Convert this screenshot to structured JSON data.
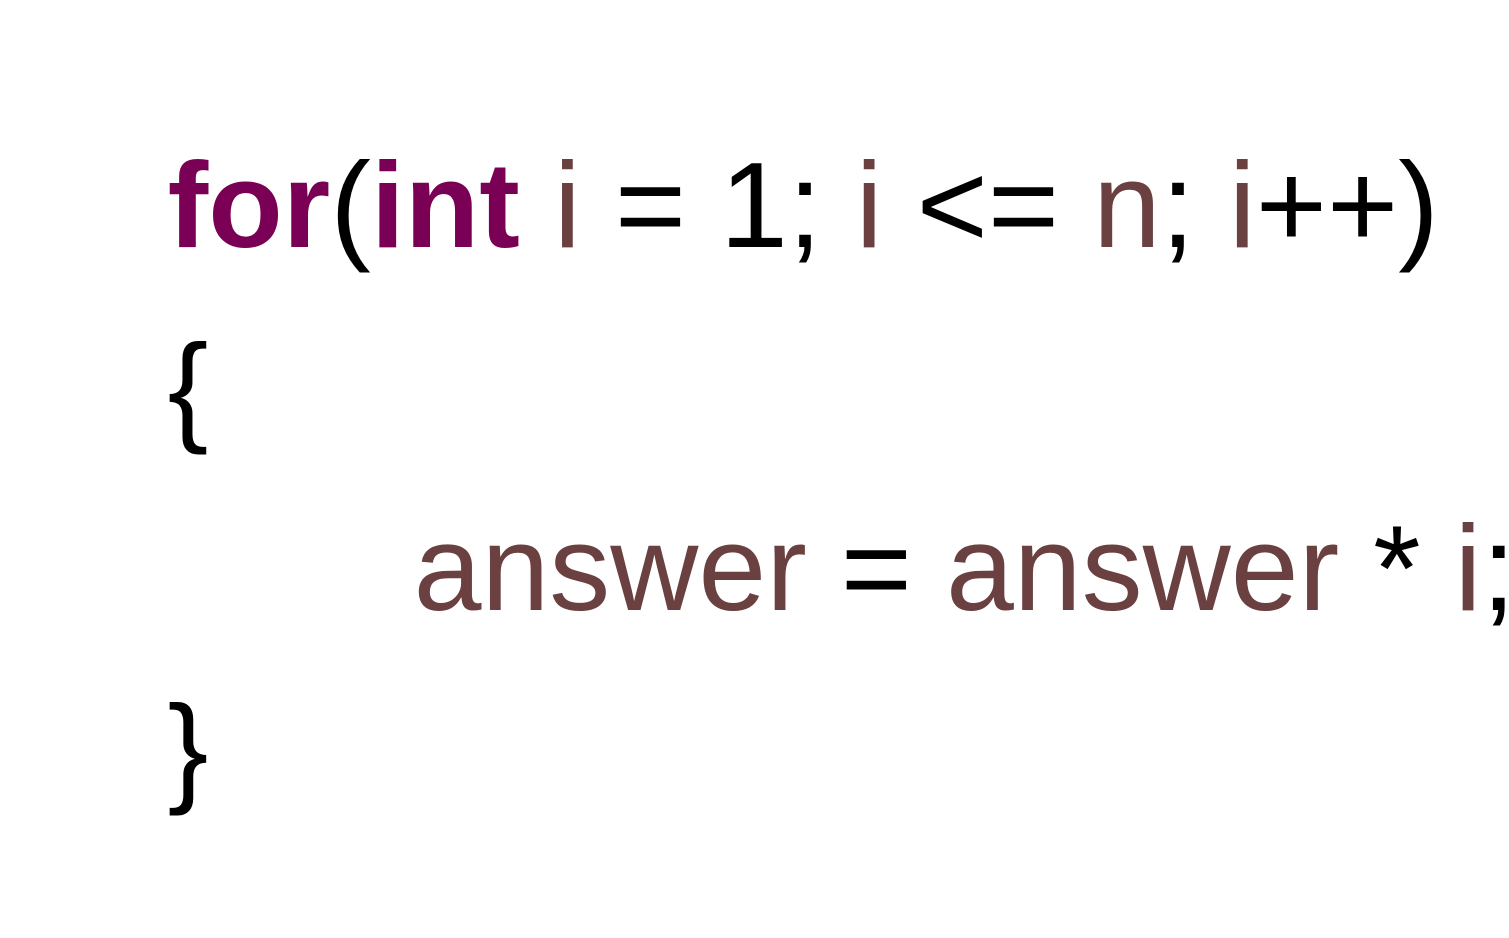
{
  "colors": {
    "keyword": "#7a0055",
    "identifier": "#6b4040",
    "punctuation": "#000000",
    "background": "#ffffff"
  },
  "code": {
    "line1": [
      {
        "text": "for",
        "role": "keyword"
      },
      {
        "text": "(",
        "role": "punctuation"
      },
      {
        "text": "int",
        "role": "keyword"
      },
      {
        "text": " ",
        "role": "punctuation"
      },
      {
        "text": "i",
        "role": "identifier"
      },
      {
        "text": " = 1; ",
        "role": "punctuation"
      },
      {
        "text": "i",
        "role": "identifier"
      },
      {
        "text": " <= ",
        "role": "punctuation"
      },
      {
        "text": "n",
        "role": "identifier"
      },
      {
        "text": "; ",
        "role": "punctuation"
      },
      {
        "text": "i",
        "role": "identifier"
      },
      {
        "text": "++)",
        "role": "punctuation"
      }
    ],
    "line2": [
      {
        "text": "{",
        "role": "punctuation"
      }
    ],
    "line3": [
      {
        "text": "answer",
        "role": "identifier"
      },
      {
        "text": " = ",
        "role": "punctuation"
      },
      {
        "text": "answer",
        "role": "identifier"
      },
      {
        "text": " * ",
        "role": "punctuation"
      },
      {
        "text": "i",
        "role": "identifier"
      },
      {
        "text": ";",
        "role": "punctuation"
      }
    ],
    "line4": [
      {
        "text": "}",
        "role": "punctuation"
      }
    ]
  }
}
